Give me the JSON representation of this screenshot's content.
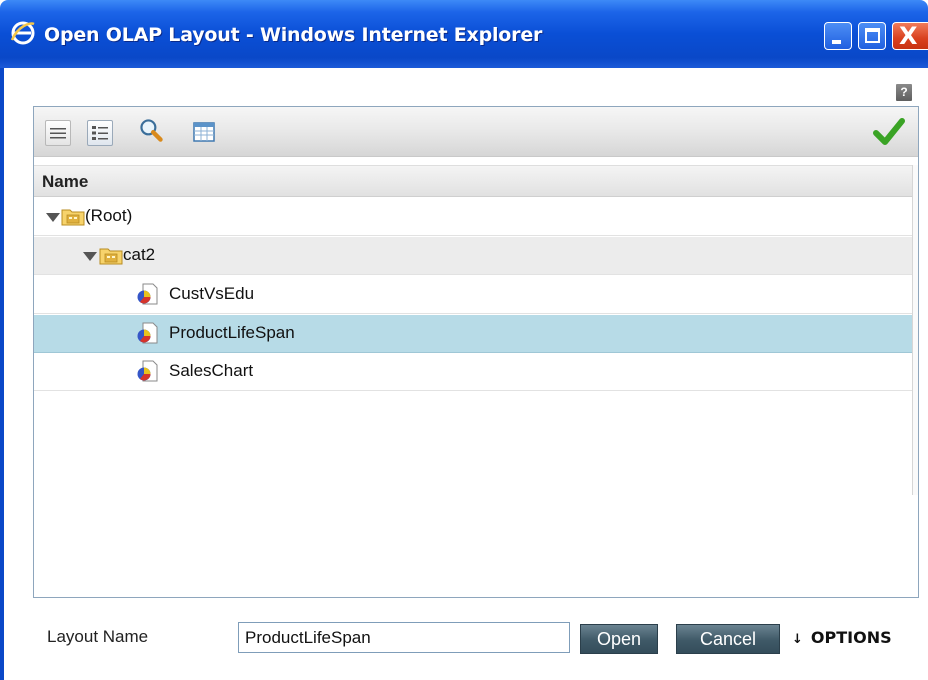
{
  "window": {
    "title": "Open OLAP Layout - Windows Internet Explorer",
    "icon": "ie-icon",
    "controls": [
      "minimize-icon",
      "maximize-icon",
      "close-icon"
    ],
    "close_glyph": "X"
  },
  "help": {
    "icon": "help-icon",
    "glyph": "?"
  },
  "toolbar": {
    "items": [
      "list-view-icon",
      "detail-view-icon",
      "search-icon",
      "table-icon"
    ],
    "confirm": "checkmark-icon"
  },
  "grid": {
    "column_header": "Name",
    "rows": [
      {
        "label": "(Root)",
        "type": "folder",
        "expanded": true,
        "level": 0
      },
      {
        "label": "cat2",
        "type": "folder",
        "expanded": true,
        "level": 1
      },
      {
        "label": "CustVsEdu",
        "type": "layout",
        "level": 2
      },
      {
        "label": "ProductLifeSpan",
        "type": "layout",
        "level": 2,
        "selected": true
      },
      {
        "label": "SalesChart",
        "type": "layout",
        "level": 2
      }
    ]
  },
  "form": {
    "layout_name_label": "Layout Name",
    "layout_name_value": "ProductLifeSpan",
    "open_label": "Open",
    "cancel_label": "Cancel",
    "options_label": "OPTIONS",
    "options_icon": "double-chevron-down-icon"
  },
  "colors": {
    "titlebar": "#0a4fd6",
    "selected_row": "#b7dbe7",
    "button": "#3f5967"
  }
}
